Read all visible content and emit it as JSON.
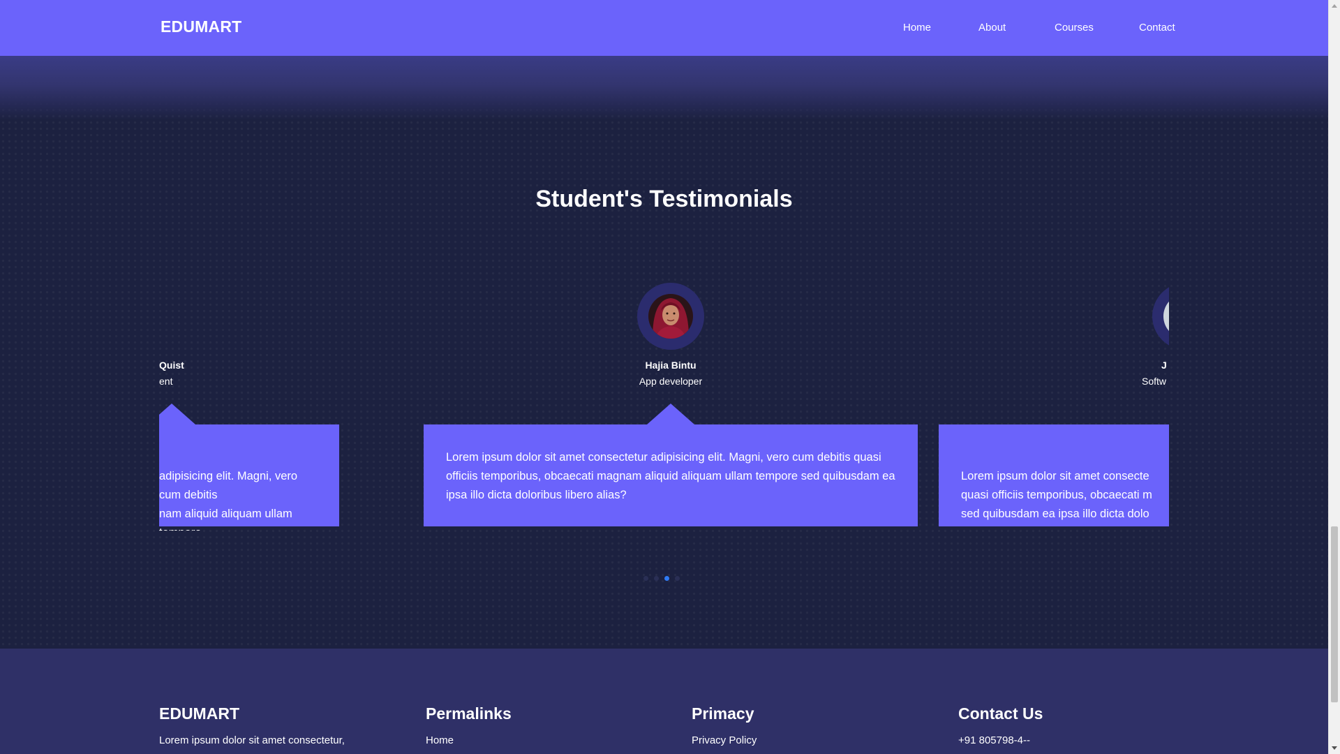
{
  "navbar": {
    "brand": "EDUMART",
    "links": [
      "Home",
      "About",
      "Courses",
      "Contact"
    ]
  },
  "testimonials": {
    "title": "Student's Testimonials",
    "slides": [
      {
        "name": "Quist",
        "role": "ent",
        "quote": "adipisicing elit. Magni, vero cum debitis\nnam aliquid aliquam ullam tempore\ns libero alias?"
      },
      {
        "name": "Hajia Bintu",
        "role": "App developer",
        "quote": "Lorem ipsum dolor sit amet consectetur adipisicing elit. Magni, vero cum debitis quasi officiis temporibus, obcaecati magnam aliquid aliquam ullam tempore sed quibusdam ea ipsa illo dicta doloribus libero alias?"
      },
      {
        "name": "J",
        "role": "Softw",
        "quote": "Lorem ipsum dolor sit amet consecte\nquasi officiis temporibus, obcaecati m\nsed quibusdam ea ipsa illo dicta dolo"
      }
    ],
    "dots": 4,
    "active_dot": 2
  },
  "footer": {
    "columns": [
      {
        "heading": "EDUMART",
        "text": "Lorem ipsum dolor sit amet consectetur,"
      },
      {
        "heading": "Permalinks",
        "text": "Home"
      },
      {
        "heading": "Primacy",
        "text": "Privacy Policy"
      },
      {
        "heading": "Contact Us",
        "text": "+91 805798-4--"
      }
    ]
  },
  "colors": {
    "accent": "#6b63fb",
    "background": "#1c2140",
    "footer": "#2f3067",
    "active_dot": "#2f7bf5"
  },
  "icons": {
    "avatars": [
      "avatar-photo",
      "avatar-photo",
      "avatar-photo"
    ]
  }
}
